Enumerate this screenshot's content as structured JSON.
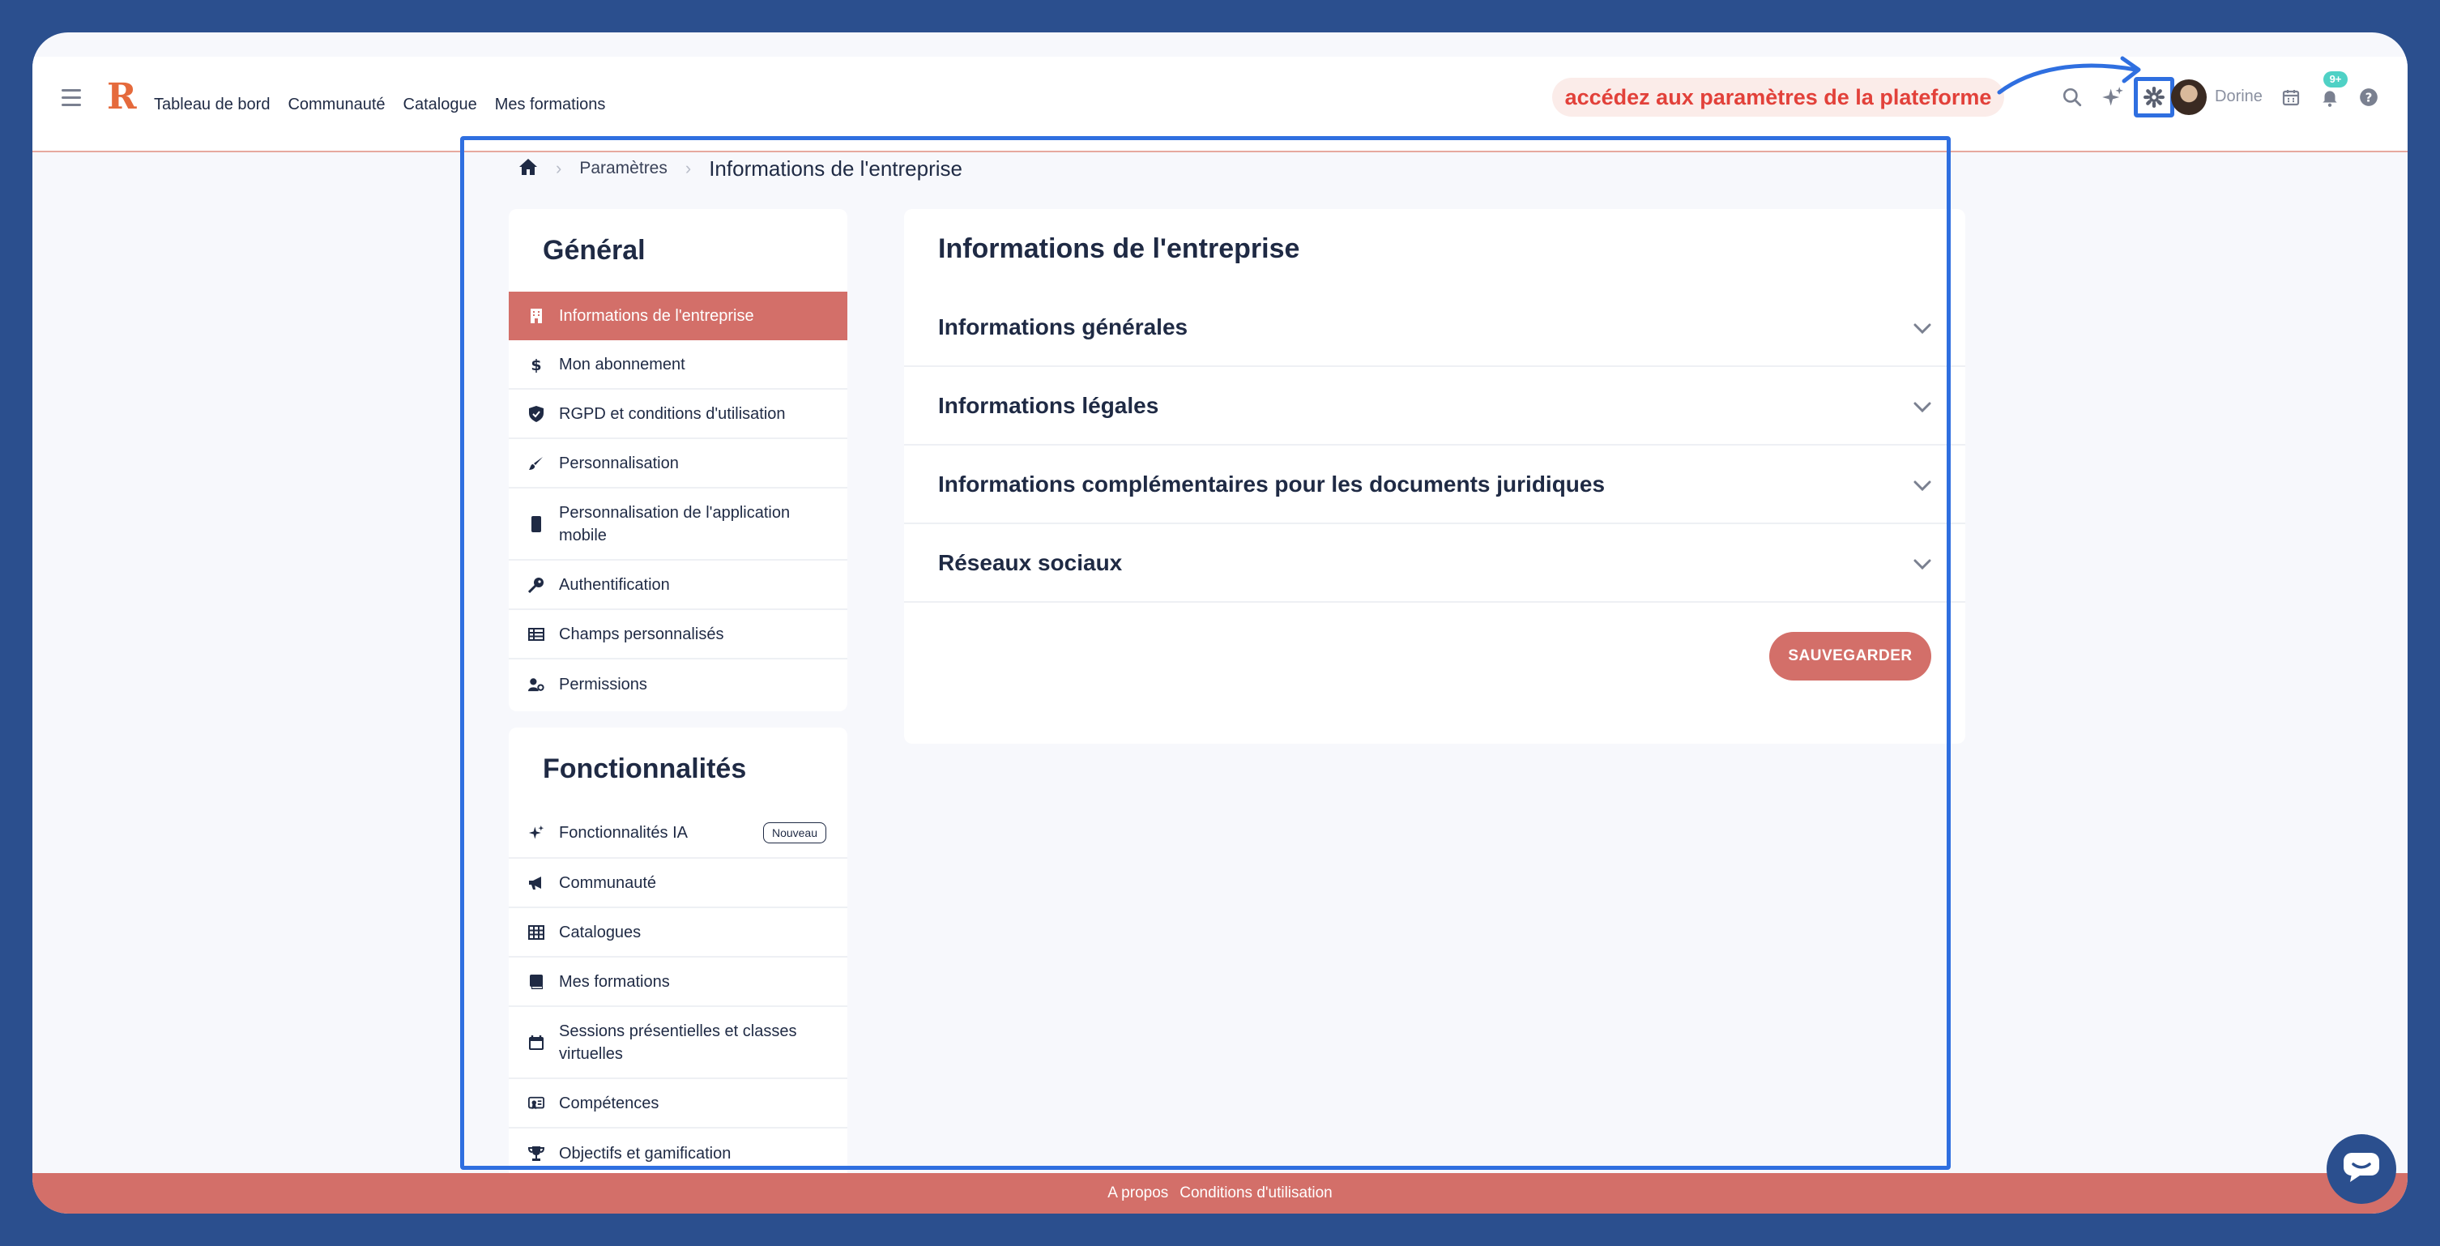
{
  "header": {
    "nav": [
      "Tableau de bord",
      "Communauté",
      "Catalogue",
      "Mes formations"
    ],
    "annotation": "accédez aux paramètres de la plateforme",
    "user_name": "Dorine",
    "notification_badge": "9+"
  },
  "breadcrumb": {
    "link": "Paramètres",
    "current": "Informations de l'entreprise"
  },
  "sidebar": {
    "general_title": "Général",
    "general_items": [
      {
        "label": "Informations de l'entreprise",
        "icon": "building-icon",
        "active": true
      },
      {
        "label": "Mon abonnement",
        "icon": "dollar-icon"
      },
      {
        "label": "RGPD et conditions d'utilisation",
        "icon": "shield-icon"
      },
      {
        "label": "Personnalisation",
        "icon": "brush-icon"
      },
      {
        "label": "Personnalisation de l'application mobile",
        "icon": "phone-icon"
      },
      {
        "label": "Authentification",
        "icon": "key-icon"
      },
      {
        "label": "Champs personnalisés",
        "icon": "table-icon"
      },
      {
        "label": "Permissions",
        "icon": "user-gear-icon"
      }
    ],
    "func_title": "Fonctionnalités",
    "func_items": [
      {
        "label": "Fonctionnalités IA",
        "icon": "sparkle-icon",
        "badge": "Nouveau"
      },
      {
        "label": "Communauté",
        "icon": "megaphone-icon"
      },
      {
        "label": "Catalogues",
        "icon": "grid-icon"
      },
      {
        "label": "Mes formations",
        "icon": "book-icon"
      },
      {
        "label": "Sessions présentielles et classes virtuelles",
        "icon": "calendar-icon"
      },
      {
        "label": "Compétences",
        "icon": "certificate-icon"
      },
      {
        "label": "Objectifs et gamification",
        "icon": "trophy-icon"
      }
    ]
  },
  "main": {
    "title": "Informations de l'entreprise",
    "sections": [
      "Informations générales",
      "Informations légales",
      "Informations complémentaires pour les documents juridiques",
      "Réseaux sociaux"
    ],
    "save_label": "SAUVEGARDER"
  },
  "footer": {
    "about": "A propos",
    "terms": "Conditions d'utilisation"
  },
  "colors": {
    "accent": "#d36f69",
    "highlight": "#2f6fe0",
    "annotation_text": "#e2413a",
    "background": "#2b4f8e"
  }
}
